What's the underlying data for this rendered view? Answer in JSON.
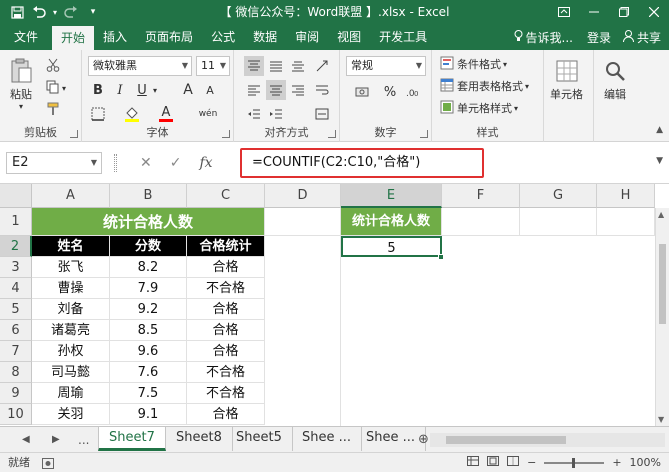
{
  "window": {
    "title": "【 微信公众号：Word联盟 】.xlsx - Excel",
    "qat": [
      "save-icon",
      "undo-icon",
      "redo-icon",
      "customize-icon"
    ]
  },
  "tabs": [
    "文件",
    "开始",
    "插入",
    "页面布局",
    "公式",
    "数据",
    "审阅",
    "视图",
    "开发工具"
  ],
  "tab_active": "开始",
  "tell_me": "告诉我...",
  "signin": "登录",
  "share": "共享",
  "ribbon": {
    "clipboard": {
      "label": "剪贴板",
      "paste": "粘贴"
    },
    "font": {
      "label": "字体",
      "name": "微软雅黑",
      "size": "11",
      "bold": "B",
      "italic": "I",
      "underline": "U",
      "grow": "A",
      "shrink": "A",
      "phonetic": "wén"
    },
    "alignment": {
      "label": "对齐方式"
    },
    "number": {
      "label": "数字",
      "format": "常规",
      "percent": "%"
    },
    "styles": {
      "label": "样式",
      "cond": "条件格式",
      "table": "套用表格格式",
      "cell": "单元格样式"
    },
    "cells": {
      "label": "单元格"
    },
    "editing": {
      "label": "编辑"
    }
  },
  "formula_bar": {
    "name_box": "E2",
    "fx": "fx",
    "formula": "=COUNTIF(C2:C10,\"合格\")"
  },
  "grid": {
    "columns": [
      "A",
      "B",
      "C",
      "D",
      "E",
      "F",
      "G",
      "H"
    ],
    "rows": [
      "1",
      "2",
      "3",
      "4",
      "5",
      "6",
      "7",
      "8",
      "9",
      "10"
    ],
    "title": "统计合格人数",
    "headers": [
      "姓名",
      "分数",
      "合格统计"
    ],
    "data": [
      [
        "张飞",
        "8.2",
        "合格"
      ],
      [
        "曹操",
        "7.9",
        "不合格"
      ],
      [
        "刘备",
        "9.2",
        "合格"
      ],
      [
        "诸葛亮",
        "8.5",
        "合格"
      ],
      [
        "孙权",
        "9.6",
        "合格"
      ],
      [
        "司马懿",
        "7.6",
        "不合格"
      ],
      [
        "周瑜",
        "7.5",
        "不合格"
      ],
      [
        "关羽",
        "9.1",
        "合格"
      ]
    ],
    "e_title": "统计合格人数",
    "e_value": "5"
  },
  "sheets": {
    "nav_prev": "◀",
    "nav_next": "▶",
    "nav_more": "...",
    "tabs": [
      "Sheet7",
      "Sheet8",
      "Sheet5",
      "Shee ...",
      "Shee ..."
    ],
    "active": "Sheet7",
    "add": "⊕"
  },
  "status": {
    "ready": "就绪",
    "zoom": "100%",
    "minus": "−",
    "plus": "+"
  },
  "colors": {
    "excel_green": "#217346",
    "title_green": "#70ad47",
    "highlight_red": "#e03030"
  }
}
